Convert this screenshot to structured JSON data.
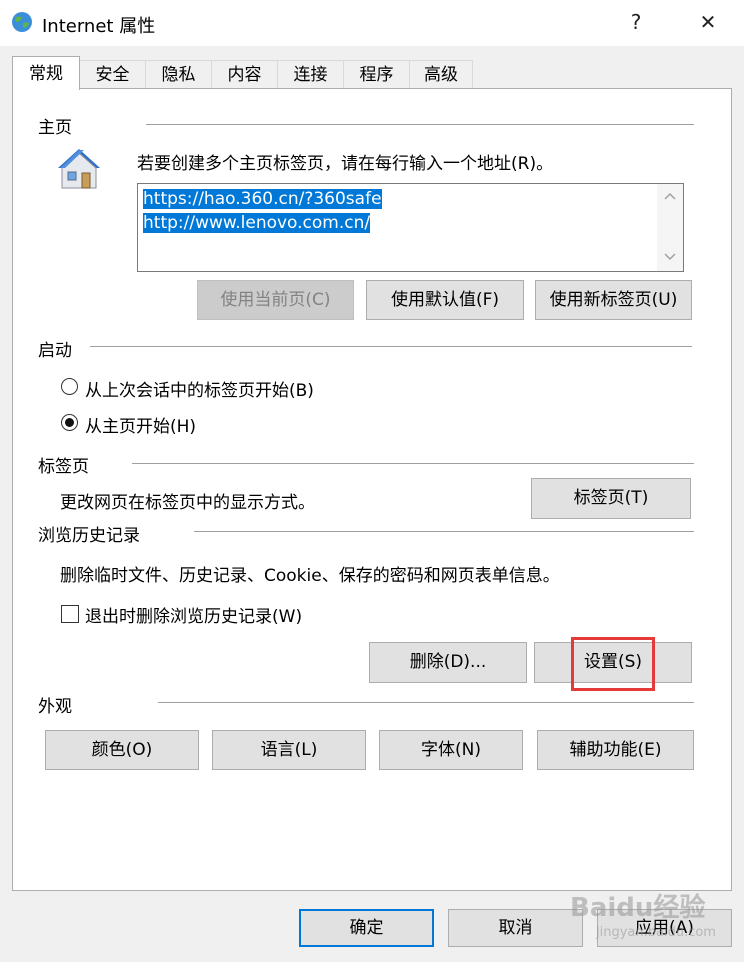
{
  "window": {
    "title": "Internet 属性",
    "help_label": "?",
    "close_label": "✕",
    "app_icon": "globe-icon"
  },
  "tabs": [
    {
      "label": "常规",
      "active": true
    },
    {
      "label": "安全"
    },
    {
      "label": "隐私"
    },
    {
      "label": "内容"
    },
    {
      "label": "连接"
    },
    {
      "label": "程序"
    },
    {
      "label": "高级"
    }
  ],
  "homepage": {
    "section_label": "主页",
    "icon": "house-icon",
    "instruction": "若要创建多个主页标签页，请在每行输入一个地址(R)。",
    "urls": [
      "https://hao.360.cn/?360safe",
      "http://www.lenovo.com.cn/"
    ],
    "use_current_label": "使用当前页(C)",
    "use_default_label": "使用默认值(F)",
    "use_new_tab_label": "使用新标签页(U)"
  },
  "startup": {
    "section_label": "启动",
    "option_last_session": "从上次会话中的标签页开始(B)",
    "option_home": "从主页开始(H)",
    "selected": "option_home"
  },
  "tabs_section": {
    "section_label": "标签页",
    "description": "更改网页在标签页中的显示方式。",
    "button_label": "标签页(T)"
  },
  "history": {
    "section_label": "浏览历史记录",
    "description": "删除临时文件、历史记录、Cookie、保存的密码和网页表单信息。",
    "delete_on_exit_label": "退出时删除浏览历史记录(W)",
    "delete_on_exit_checked": false,
    "delete_label": "删除(D)...",
    "settings_label": "设置(S)"
  },
  "appearance": {
    "section_label": "外观",
    "colors_label": "颜色(O)",
    "languages_label": "语言(L)",
    "fonts_label": "字体(N)",
    "accessibility_label": "辅助功能(E)"
  },
  "footer": {
    "ok_label": "确定",
    "cancel_label": "取消",
    "apply_label": "应用(A)"
  },
  "watermark": {
    "text": "Baidu经验",
    "subtext": "jingyan.baidu.com"
  },
  "colors": {
    "accent": "#0078d7",
    "highlight_box": "#e53a3a"
  }
}
